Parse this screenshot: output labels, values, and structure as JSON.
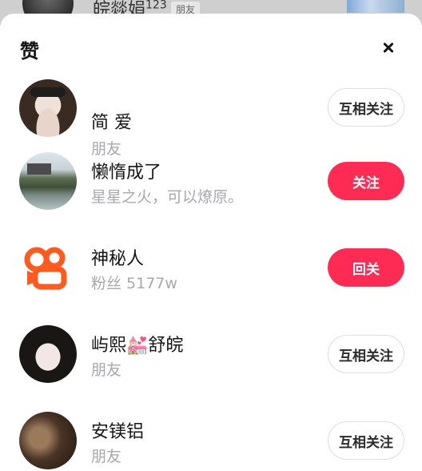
{
  "background": {
    "name": "皖燚娟",
    "name_sup": "123",
    "tag": "朋友"
  },
  "sheet": {
    "title": "赞",
    "close_icon": "close-icon"
  },
  "items": [
    {
      "name": "简 爱",
      "subtitle": "朋友",
      "button": "互相关注",
      "button_style": "outline"
    },
    {
      "name": "懒惰成了",
      "subtitle": "星星之火，可以燎原。",
      "button": "关注",
      "button_style": "filled"
    },
    {
      "name": "神秘人",
      "subtitle": "粉丝 5177w",
      "button": "回关",
      "button_style": "filled"
    },
    {
      "name": "屿熙💒舒皖",
      "subtitle": "朋友",
      "button": "互相关注",
      "button_style": "outline"
    },
    {
      "name": "安镁铝",
      "subtitle": "朋友",
      "button": "互相关注",
      "button_style": "outline"
    }
  ],
  "colors": {
    "accent": "#fe2c55",
    "kuaishou_logo": "#ff5a1f"
  }
}
